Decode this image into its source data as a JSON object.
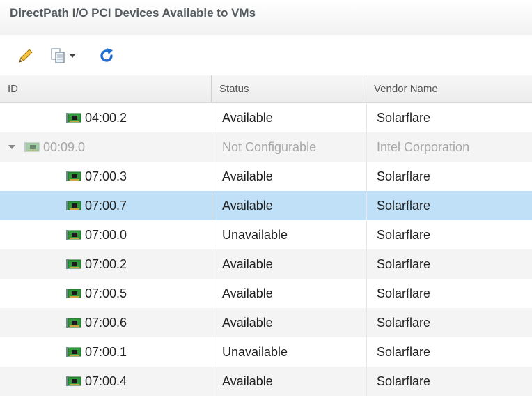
{
  "panel": {
    "title": "DirectPath I/O PCI Devices Available to VMs"
  },
  "toolbar": {
    "edit_icon": "pencil-icon",
    "copy_icon": "copy-dropdown-icon",
    "refresh_icon": "refresh-icon",
    "accent_color": "#1f6fd0"
  },
  "table": {
    "columns": [
      "ID",
      "Status",
      "Vendor Name"
    ],
    "rows": [
      {
        "id": "04:00.2",
        "status": "Available",
        "vendor": "Solarflare"
      },
      {
        "id": "00:09.0",
        "status": "Not Configurable",
        "vendor": "Intel Corporation"
      },
      {
        "id": "07:00.3",
        "status": "Available",
        "vendor": "Solarflare"
      },
      {
        "id": "07:00.7",
        "status": "Available",
        "vendor": "Solarflare"
      },
      {
        "id": "07:00.0",
        "status": "Unavailable",
        "vendor": "Solarflare"
      },
      {
        "id": "07:00.2",
        "status": "Available",
        "vendor": "Solarflare"
      },
      {
        "id": "07:00.5",
        "status": "Available",
        "vendor": "Solarflare"
      },
      {
        "id": "07:00.6",
        "status": "Available",
        "vendor": "Solarflare"
      },
      {
        "id": "07:00.1",
        "status": "Unavailable",
        "vendor": "Solarflare"
      },
      {
        "id": "07:00.4",
        "status": "Available",
        "vendor": "Solarflare"
      }
    ],
    "selected_row_color": "#bfe0f6"
  }
}
